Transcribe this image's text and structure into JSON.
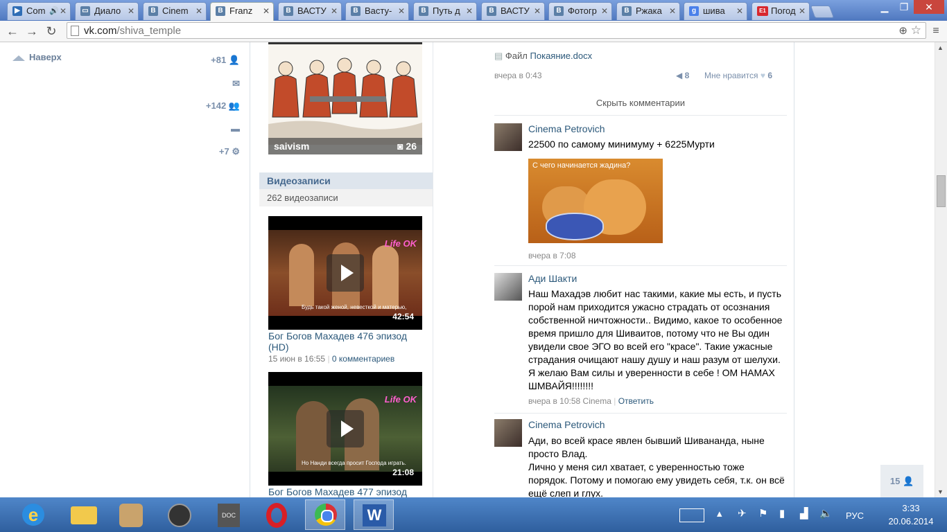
{
  "tabs": [
    {
      "label": "Com",
      "icon": "play-icon",
      "audio": true
    },
    {
      "label": "Диало",
      "icon": "chat-icon"
    },
    {
      "label": "Cinem",
      "icon": "vk-icon"
    },
    {
      "label": "Franz",
      "icon": "vk-icon",
      "active": true
    },
    {
      "label": "ВАСТУ",
      "icon": "vk-icon"
    },
    {
      "label": "Васту-",
      "icon": "vk-icon"
    },
    {
      "label": "Путь д",
      "icon": "vk-icon"
    },
    {
      "label": "ВАСТУ",
      "icon": "vk-icon"
    },
    {
      "label": "Фотогр",
      "icon": "vk-icon"
    },
    {
      "label": "Ржака",
      "icon": "vk-icon"
    },
    {
      "label": "шива",
      "icon": "google-icon"
    },
    {
      "label": "Погод",
      "icon": "e1-icon"
    }
  ],
  "toolbar": {
    "url_host": "vk.com",
    "url_path": "/shiva_temple"
  },
  "left": {
    "top_label": "Наверх",
    "counters": [
      {
        "value": "+81",
        "icon": "user-icon"
      },
      {
        "value": "",
        "icon": "mail-icon"
      },
      {
        "value": "+142",
        "icon": "friends-icon"
      },
      {
        "value": "",
        "icon": "chat-icon"
      },
      {
        "value": "+7",
        "icon": "gear-icon"
      }
    ]
  },
  "album": {
    "name": "saivism",
    "count": "26"
  },
  "videos": {
    "header": "Видеозаписи",
    "count": "262 видеозаписи",
    "items": [
      {
        "title": "Бог Богов Махадев 476 эпизод (HD)",
        "duration": "42:54",
        "date": "15 июн в 16:55",
        "comments": "0 комментариев",
        "subtitle": "Будь такой женой, невесткой и матерью,",
        "channel": "Life OK"
      },
      {
        "title": "Бог Богов Махадев 477 эпизод",
        "duration": "21:08",
        "subtitle": "Но Нанди всегда просит Господа играть.",
        "channel": "Life OK"
      }
    ]
  },
  "post": {
    "file_label": "Файл",
    "file_name": "Покаяние.docx",
    "time": "вчера в 0:43",
    "reposts": "8",
    "like_label": "Мне нравится",
    "likes": "6",
    "hide_comments": "Скрыть комментарии"
  },
  "comments": [
    {
      "author": "Cinema Petrovich",
      "text": "22500 по самому минимуму + 6225Мурти",
      "image_caption": "С чего начинается жадина?",
      "date": "вчера в 7:08"
    },
    {
      "author": "Ади Шакти",
      "text": "Наш Махадэв любит нас такими, какие мы есть, и пусть порой нам приходится ужасно страдать от осознания собственной ничтожности.. Видимо, какое то особенное время пришло для Шиваитов, потому что не Вы один увидели свое ЭГО во всей его \"красе\". Такие ужасные страдания очищают нашу душу и наш разум от шелухи. Я желаю Вам силы и уверенности в себе ! ОМ НАМАХ ШМВАЙЯ!!!!!!!!",
      "date": "вчера в 10:58",
      "reply_to": "Cinema",
      "reply": "Ответить"
    },
    {
      "author": "Cinema Petrovich",
      "text_lines": [
        "Ади, во всей красе явлен бывший Шивананда, ныне просто Влад.",
        "Лично у меня сил хватает, с уверенностью тоже порядок. Потому и помогаю ему увидеть себя, т.к. он всё ещё слеп и глух."
      ]
    }
  ],
  "minichat": {
    "count": "15"
  },
  "taskbar": {
    "apps": [
      "ie-icon",
      "explorer-icon",
      "gallery-icon",
      "speaker-icon",
      "doc-icon",
      "opera-icon",
      "chrome-icon",
      "word-icon"
    ],
    "lang": "РУС",
    "time": "3:33",
    "date": "20.06.2014"
  },
  "colors": {
    "link": "#2b587a",
    "header_bg": "#dee5ed",
    "taskbar": "#3c6fb1"
  }
}
